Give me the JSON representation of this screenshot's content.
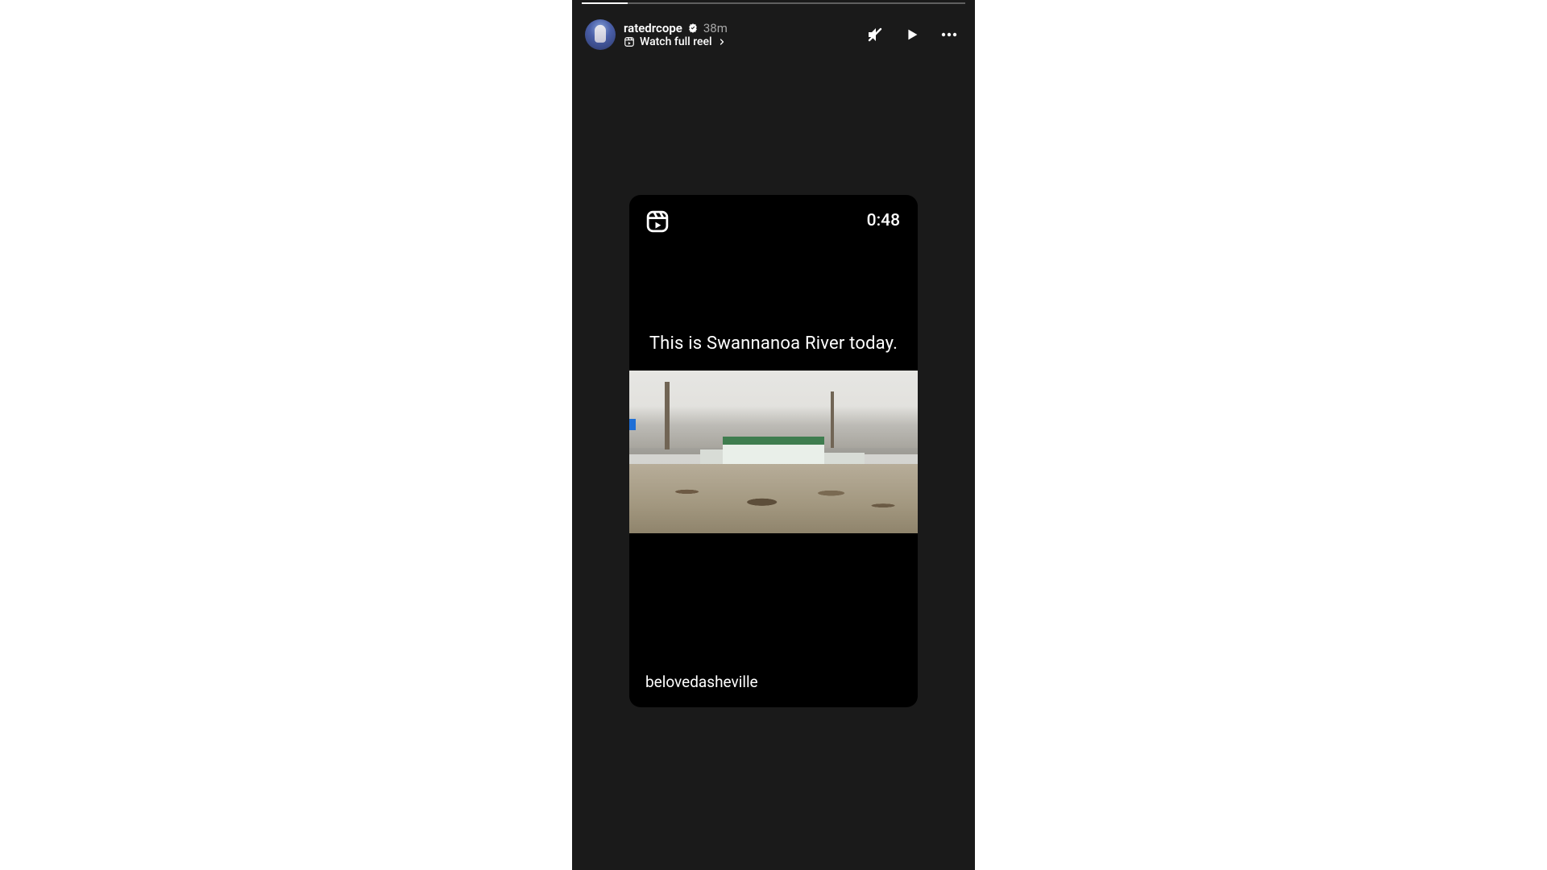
{
  "header": {
    "username": "ratedrcope",
    "timestamp": "38m",
    "watch_full_reel": "Watch full reel"
  },
  "reel": {
    "duration": "0:48",
    "caption": "This is Swannanoa River today.",
    "credit": "belovedasheville"
  }
}
